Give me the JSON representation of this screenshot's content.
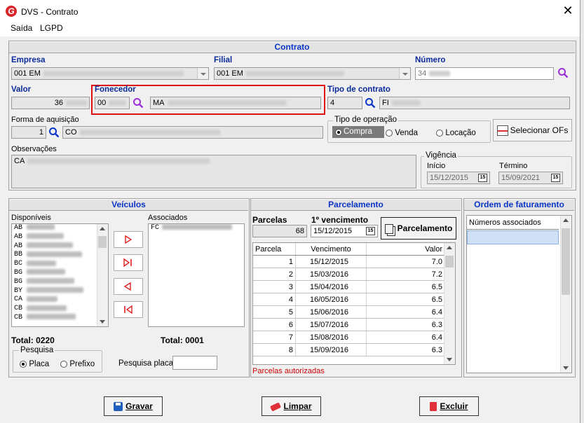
{
  "window": {
    "title": "DVS - Contrato",
    "close_glyph": "✕",
    "app_icon_letter": "G"
  },
  "menu": {
    "items": [
      "Saída",
      "LGPD"
    ]
  },
  "contrato": {
    "header": "Contrato",
    "empresa": {
      "label": "Empresa",
      "value": "001 EM"
    },
    "filial": {
      "label": "Filial",
      "value": "001 EM"
    },
    "numero": {
      "label": "Número",
      "value": "34"
    },
    "valor": {
      "label": "Valor",
      "value": "36"
    },
    "fornecedor": {
      "label": "Fonecedor",
      "code": "00",
      "name": "MA"
    },
    "tipo_contrato": {
      "label": "Tipo de contrato",
      "code": "4",
      "name": "FI"
    },
    "forma_aquisicao": {
      "label": "Forma de aquisição",
      "code": "1",
      "name": "CO"
    },
    "tipo_operacao": {
      "label": "Tipo de operação",
      "options": [
        "Compra",
        "Venda",
        "Locação"
      ],
      "selected": "Compra"
    },
    "selecionar_ofs": "Selecionar OFs",
    "observacoes": {
      "label": "Observações",
      "value": "CA"
    },
    "vigencia": {
      "label": "Vigência",
      "inicio_label": "Início",
      "inicio": "15/12/2015",
      "termino_label": "Término",
      "termino": "15/09/2021"
    }
  },
  "veiculos": {
    "header": "Veículos",
    "disponiveis_label": "Disponíveis",
    "disponiveis": [
      "AB",
      "AB",
      "AB",
      "BB",
      "BC",
      "BG",
      "BG",
      "BY",
      "CA",
      "CB",
      "CB"
    ],
    "associados_label": "Associados",
    "associados": [
      "FC"
    ],
    "total_disponiveis": "Total: 0220",
    "total_associados": "Total: 0001",
    "pesquisa": {
      "label": "Pesquisa",
      "options": [
        "Placa",
        "Prefixo"
      ],
      "selected": "Placa",
      "field_label": "Pesquisa placa",
      "value": ""
    }
  },
  "parcelamento": {
    "header": "Parcelamento",
    "parcelas_label": "Parcelas",
    "parcelas": "68",
    "primeiro_venc_label": "1º vencimento",
    "primeiro_venc": "15/12/2015",
    "button": "Parcelamento",
    "columns": [
      "Parcela",
      "Vencimento",
      "Valor"
    ],
    "rows": [
      {
        "parcela": "1",
        "vencimento": "15/12/2015",
        "valor": "7.0"
      },
      {
        "parcela": "2",
        "vencimento": "15/03/2016",
        "valor": "7.2"
      },
      {
        "parcela": "3",
        "vencimento": "15/04/2016",
        "valor": "6.5"
      },
      {
        "parcela": "4",
        "vencimento": "16/05/2016",
        "valor": "6.5"
      },
      {
        "parcela": "5",
        "vencimento": "15/06/2016",
        "valor": "6.4"
      },
      {
        "parcela": "6",
        "vencimento": "15/07/2016",
        "valor": "6.3"
      },
      {
        "parcela": "7",
        "vencimento": "15/08/2016",
        "valor": "6.4"
      },
      {
        "parcela": "8",
        "vencimento": "15/09/2016",
        "valor": "6.3"
      }
    ],
    "status": "Parcelas autorizadas",
    "status_color": "#cc0000"
  },
  "ordem_faturamento": {
    "header": "Ordem de faturamento",
    "column": "Números associados"
  },
  "footer": {
    "gravar": "Gravar",
    "limpar": "Limpar",
    "excluir": "Excluir"
  },
  "icons": {
    "search": "magnifier-icon",
    "calendar": "calendar-icon",
    "calendar_text": "15"
  },
  "colors": {
    "accent": "#0a35c8",
    "highlight_box": "#e01010",
    "search_icon": "#9b30d9"
  }
}
